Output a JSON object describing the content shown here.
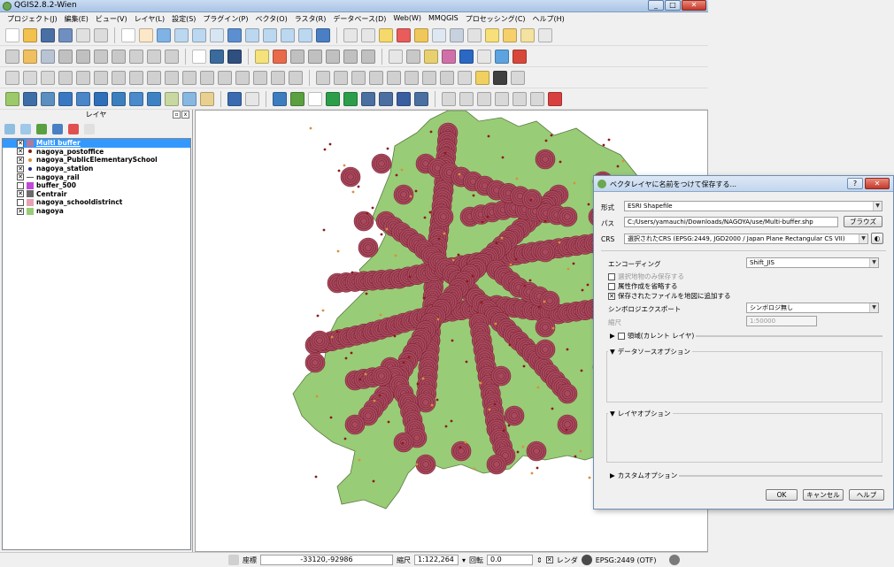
{
  "window": {
    "title": "QGIS2.8.2-Wien",
    "minimize": "_",
    "maximize": "□",
    "close": "✕"
  },
  "menu": [
    "プロジェクト(J)",
    "編集(E)",
    "ビュー(V)",
    "レイヤ(L)",
    "設定(S)",
    "プラグイン(P)",
    "ベクタ(O)",
    "ラスタ(R)",
    "データベース(D)",
    "Web(W)",
    "MMQGIS",
    "プロセッシング(C)",
    "ヘルプ(H)"
  ],
  "layers_panel": {
    "title": "レイヤ",
    "layers": [
      {
        "name": "Multi buffer",
        "checked": true,
        "color": "#b07aa0",
        "symbol": "square",
        "selected": true
      },
      {
        "name": "nagoya_postoffice",
        "checked": true,
        "color": "#8b1a1a",
        "symbol": "dot"
      },
      {
        "name": "nagoya_PublicElementarySchool",
        "checked": true,
        "color": "#d6913a",
        "symbol": "dot"
      },
      {
        "name": "nagoya_station",
        "checked": true,
        "color": "#2a2a8a",
        "symbol": "dot"
      },
      {
        "name": "nagoya_rail",
        "checked": true,
        "color": "#555555",
        "symbol": "line"
      },
      {
        "name": "buffer_500",
        "checked": false,
        "color": "#c04ad6",
        "symbol": "square"
      },
      {
        "name": "Centrair",
        "checked": true,
        "color": "#6b6b6b",
        "symbol": "square"
      },
      {
        "name": "nagoya_schooldistrinct",
        "checked": false,
        "color": "#e7a1b3",
        "symbol": "square"
      },
      {
        "name": "nagoya",
        "checked": true,
        "color": "#99cc77",
        "symbol": "square"
      }
    ]
  },
  "status": {
    "coord_label": "座標",
    "coord_value": "-33120,-92986",
    "scale_label": "縮尺",
    "scale_value": "1:122,264",
    "rotation_label": "回転",
    "rotation_value": "0.0",
    "render_label": "レンダ",
    "crs": "EPSG:2449 (OTF)"
  },
  "dialog": {
    "title": "ベクタレイヤに名前をつけて保存する...",
    "format_label": "形式",
    "format_value": "ESRI Shapefile",
    "path_label": "パス",
    "path_value": "C:/Users/yamauchi/Downloads/NAGOYA/use/Multi-buffer.shp",
    "browse_label": "ブラウズ",
    "crs_label": "CRS",
    "crs_value": "選択されたCRS (EPSG:2449, JGD2000 / Japan Plane Rectangular CS VII)",
    "encoding_label": "エンコーディング",
    "encoding_value": "Shift_JIS",
    "selected_only": "選択地物のみ保存する",
    "skip_attr": "属性作成を省略する",
    "add_to_map": "保存されたファイルを地図に追加する",
    "symbology_label": "シンボロジエクスポート",
    "symbology_value": "シンボロジ無し",
    "scale_label": "縮尺",
    "scale_value": "1:50000",
    "extent_label": "領域(カレント レイヤ)",
    "datasource_label": "データソースオプション",
    "layer_opts_label": "レイヤオプション",
    "custom_opts_label": "カスタムオプション",
    "ok_label": "OK",
    "cancel_label": "キャンセル",
    "help_label": "ヘルプ"
  },
  "colors": {
    "land": "#99cc77",
    "buffer": "#a8495e",
    "buffer_ring": "#7a2232",
    "selection": "#3399ff"
  }
}
